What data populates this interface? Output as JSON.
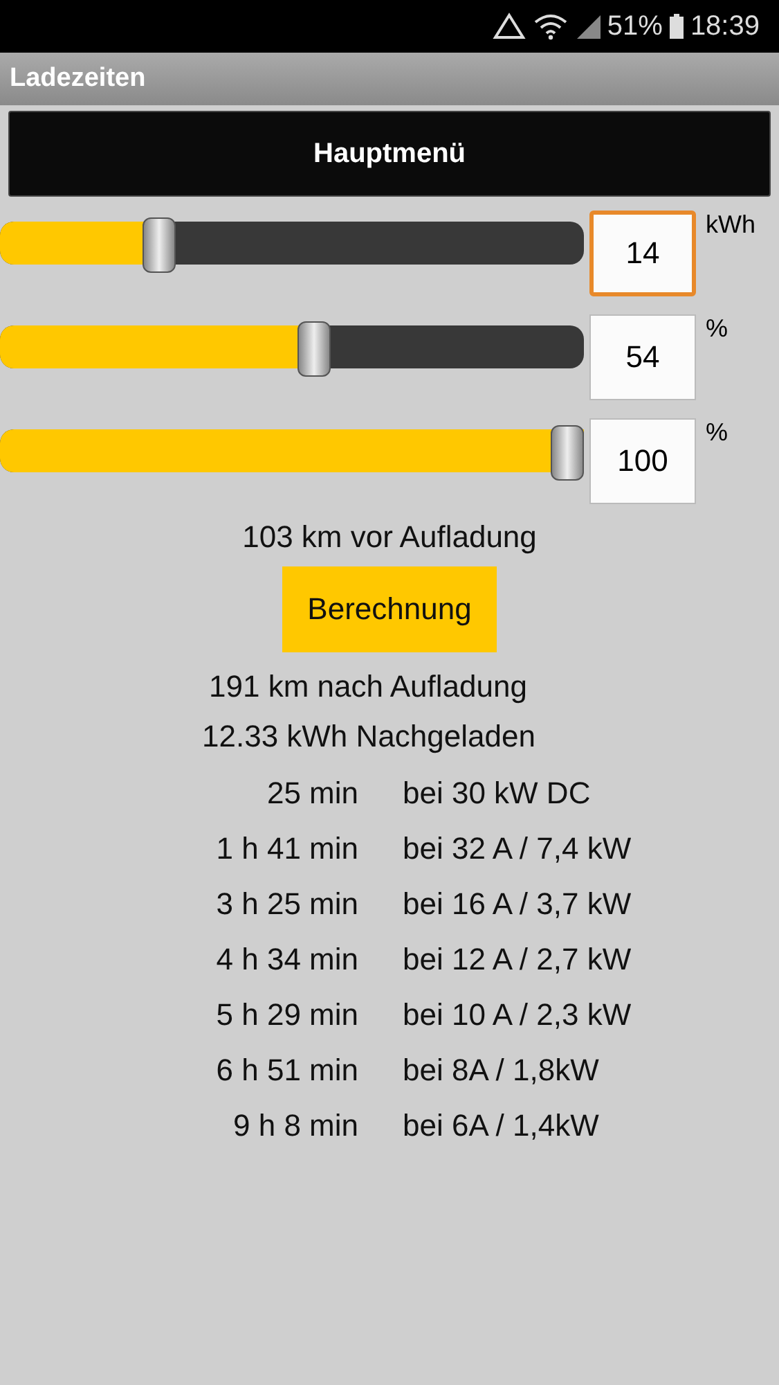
{
  "status_bar": {
    "battery": "51%",
    "time": "18:39"
  },
  "window": {
    "title": "Ladezeiten"
  },
  "main_menu_button": "Hauptmenü",
  "sliders": [
    {
      "level": 0.26,
      "value": "14",
      "unit": "kWh",
      "focused": true
    },
    {
      "level": 0.54,
      "value": "54",
      "unit": "%",
      "focused": false
    },
    {
      "level": 1.0,
      "value": "100",
      "unit": "%",
      "focused": false
    }
  ],
  "range_before": "103 km vor Aufladung",
  "calculate_button": "Berechnung",
  "range_after": "191 km nach Aufladung",
  "energy_charged": "12.33 kWh Nachgeladen",
  "charge_times": [
    {
      "duration": "25 min",
      "power": "bei 30 kW DC"
    },
    {
      "duration": "1 h 41 min",
      "power": "bei 32 A / 7,4 kW"
    },
    {
      "duration": "3 h 25 min",
      "power": "bei 16 A / 3,7 kW"
    },
    {
      "duration": "4 h 34 min",
      "power": "bei 12 A / 2,7 kW"
    },
    {
      "duration": "5 h 29 min",
      "power": "bei 10 A / 2,3 kW"
    },
    {
      "duration": "6 h 51 min",
      "power": "bei 8A / 1,8kW"
    },
    {
      "duration": "9 h 8 min",
      "power": "bei 6A / 1,4kW"
    }
  ]
}
